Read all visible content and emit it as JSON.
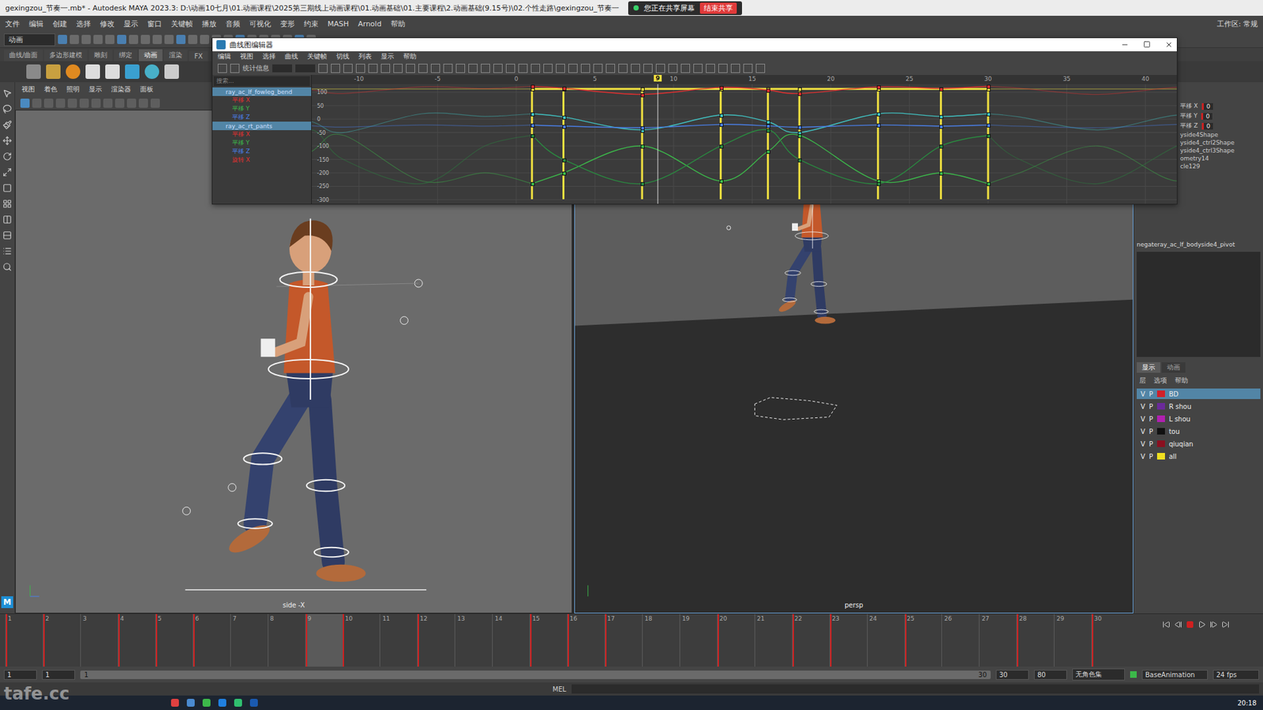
{
  "window": {
    "title": "gexingzou_节奏一.mb* - Autodesk MAYA 2023.3: D:\\动画10七月\\01.动画课程\\2025第三期线上动画课程\\01.动画基础\\01.主要课程\\2.动画基础(9.15号)\\02.个性走路\\gexingzou_节奏一",
    "sharing": "您正在共享屏幕",
    "stop_sharing": "结束共享",
    "workspace": "工作区: 常规"
  },
  "menu": [
    "文件",
    "编辑",
    "创建",
    "选择",
    "修改",
    "显示",
    "窗口",
    "关键帧",
    "播放",
    "音频",
    "可视化",
    "变形",
    "约束",
    "MASH",
    "Arnold",
    "帮助"
  ],
  "mode": "动画",
  "shelf_tabs": [
    {
      "label": "曲线/曲面",
      "selected": false
    },
    {
      "label": "多边形建模",
      "selected": false
    },
    {
      "label": "雕刻",
      "selected": false
    },
    {
      "label": "绑定",
      "selected": false
    },
    {
      "label": "动画",
      "selected": true
    },
    {
      "label": "渲染",
      "selected": false
    },
    {
      "label": "FX",
      "selected": false
    }
  ],
  "panel_menu": [
    "视图",
    "着色",
    "照明",
    "显示",
    "渲染器",
    "面板"
  ],
  "viewports": [
    {
      "label": "side -X"
    },
    {
      "label": "persp"
    }
  ],
  "graph_editor": {
    "title": "曲线图编辑器",
    "menu": [
      "编辑",
      "视图",
      "选择",
      "曲线",
      "关键帧",
      "切线",
      "列表",
      "显示",
      "帮助"
    ],
    "stats_label": "统计信息",
    "search_placeholder": "搜索...",
    "outliner": [
      {
        "label": "ray_ac_lf_fowleg_bend",
        "kind": "node",
        "color": "#cfe0ff",
        "selected": true
      },
      {
        "label": "平移 X",
        "kind": "channel",
        "color": "#e03030",
        "selected": false
      },
      {
        "label": "平移 Y",
        "kind": "channel",
        "color": "#3cb84a",
        "selected": false
      },
      {
        "label": "平移 Z",
        "kind": "channel",
        "color": "#4a7fe8",
        "selected": false
      },
      {
        "label": "ray_ac_rt_pants",
        "kind": "node",
        "color": "#cfe0ff",
        "selected": true
      },
      {
        "label": "平移 X",
        "kind": "channel",
        "color": "#e03030",
        "selected": false
      },
      {
        "label": "平移 Y",
        "kind": "channel",
        "color": "#3cb84a",
        "selected": false
      },
      {
        "label": "平移 Z",
        "kind": "channel",
        "color": "#4a7fe8",
        "selected": false
      },
      {
        "label": "旋转 X",
        "kind": "channel",
        "color": "#e03030",
        "selected": false
      }
    ],
    "x_ticks": [
      "-10",
      "-5",
      "0",
      "5",
      "10",
      "15",
      "20",
      "25",
      "30",
      "35",
      "40"
    ],
    "y_ticks": [
      "100",
      "50",
      "0",
      "-50",
      "-100",
      "-150",
      "-200",
      "-250",
      "-300"
    ],
    "current_frame": "9",
    "key_frames": [
      1,
      3,
      8,
      13,
      16,
      18,
      23,
      27,
      30
    ],
    "series": [
      {
        "name": "selected",
        "color": "#f0e040",
        "values": [
          112,
          112,
          112,
          112,
          112,
          112,
          112,
          112,
          112
        ]
      },
      {
        "name": "red",
        "color": "#e03030",
        "values": [
          122,
          115,
          92,
          118,
          108,
          95,
          120,
          114,
          122
        ]
      },
      {
        "name": "cyan",
        "color": "#40c0c0",
        "values": [
          20,
          8,
          -40,
          15,
          -10,
          -50,
          20,
          10,
          20
        ]
      },
      {
        "name": "blue",
        "color": "#4a7fe8",
        "values": [
          -22,
          -26,
          -32,
          -20,
          -25,
          -30,
          -22,
          -26,
          -22
        ]
      },
      {
        "name": "green",
        "color": "#3cb84a",
        "values": [
          -240,
          -200,
          -100,
          -230,
          -120,
          -60,
          -230,
          -200,
          -240
        ]
      },
      {
        "name": "dark-green",
        "color": "#2a8a40",
        "values": [
          -60,
          -150,
          -240,
          -100,
          -40,
          -150,
          -240,
          -100,
          -60
        ]
      }
    ]
  },
  "channel_box": {
    "channels": [
      {
        "name": "平移 X",
        "value": "0"
      },
      {
        "name": "平移 Y",
        "value": "0"
      },
      {
        "name": "平移 Z",
        "value": "0"
      }
    ],
    "shapes": [
      "yside4Shape",
      "yside4_ctrl2Shape",
      "yside4_ctrl3Shape",
      "ometry14",
      "cle129"
    ],
    "selected_node": "negateray_ac_lf_bodyside4_pivot"
  },
  "layer_editor": {
    "tabs": [
      {
        "label": "显示",
        "selected": true
      },
      {
        "label": "动画",
        "selected": false
      }
    ],
    "menu": [
      "层",
      "选项",
      "帮助"
    ],
    "layers": [
      {
        "v": "V",
        "p": "P",
        "name": "BD",
        "color": "#d0202a",
        "selected": true
      },
      {
        "v": "V",
        "p": "P",
        "name": "R shou",
        "color": "#6a2a9a",
        "selected": false
      },
      {
        "v": "V",
        "p": "P",
        "name": "L shou",
        "color": "#b020b0",
        "selected": false
      },
      {
        "v": "V",
        "p": "P",
        "name": "tou",
        "color": "#111111",
        "selected": false
      },
      {
        "v": "V",
        "p": "P",
        "name": "qiuqian",
        "color": "#8a1020",
        "selected": false
      },
      {
        "v": "V",
        "p": "P",
        "name": "all",
        "color": "#f0e020",
        "selected": false
      }
    ]
  },
  "timeline": {
    "frames": [
      "1",
      "2",
      "3",
      "4",
      "5",
      "6",
      "7",
      "8",
      "9",
      "10",
      "11",
      "12",
      "13",
      "14",
      "15",
      "16",
      "17",
      "18",
      "19",
      "20",
      "21",
      "22",
      "23",
      "24",
      "25",
      "26",
      "27",
      "28",
      "29",
      "30"
    ],
    "keys": [
      1,
      2,
      4,
      5,
      6,
      9,
      10,
      12,
      15,
      16,
      17,
      20,
      22,
      23,
      25,
      28,
      30
    ],
    "current": "9"
  },
  "range": {
    "start": "1",
    "play_start": "1",
    "slider_start": "1",
    "slider_end": "30",
    "play_end": "30",
    "end": "80",
    "character_set": "无角色集",
    "anim_layer": "BaseAnimation",
    "fps": "24 fps"
  },
  "command_line": {
    "language": "MEL"
  },
  "taskbar": {
    "time": "20:18"
  },
  "watermark": "tafe.cc",
  "toolbox": {
    "logo": "M"
  }
}
